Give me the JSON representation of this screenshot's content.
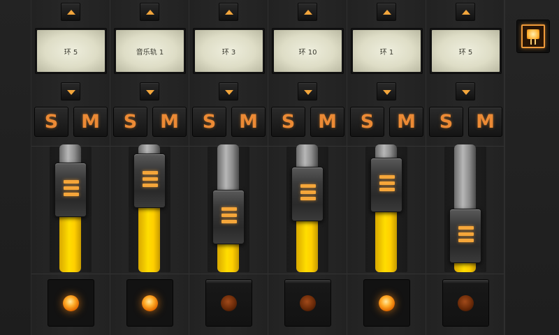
{
  "channels": [
    {
      "name": "环 5",
      "solo_label": "S",
      "mute_label": "M",
      "fader_level": 0.42,
      "led_on": true
    },
    {
      "name": "音乐轨 1",
      "solo_label": "S",
      "mute_label": "M",
      "fader_level": 0.49,
      "led_on": true
    },
    {
      "name": "环 3",
      "solo_label": "S",
      "mute_label": "M",
      "fader_level": 0.21,
      "led_on": false
    },
    {
      "name": "环 10",
      "solo_label": "S",
      "mute_label": "M",
      "fader_level": 0.39,
      "led_on": false
    },
    {
      "name": "环 1",
      "solo_label": "S",
      "mute_label": "M",
      "fader_level": 0.46,
      "led_on": true
    },
    {
      "name": "环 5",
      "solo_label": "S",
      "mute_label": "M",
      "fader_level": 0.06,
      "led_on": false
    }
  ],
  "colors": {
    "accent": "#f3a63c",
    "fader_fill": "#ffd600",
    "led_on": "#ffad2a"
  },
  "icons": {
    "scroll_up": "triangle-up-icon",
    "scroll_down": "triangle-down-icon",
    "side_button": "glowing-device-icon"
  }
}
